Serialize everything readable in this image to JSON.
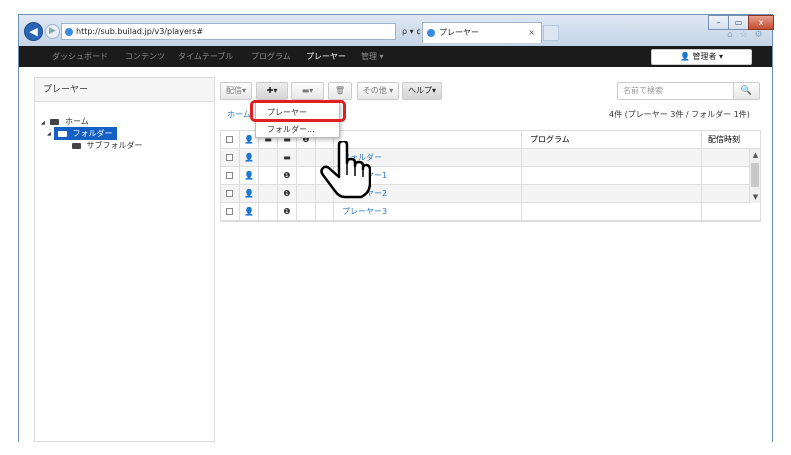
{
  "browser": {
    "url": "http://sub.builad.jp/v3/players#",
    "address_controls": "ρ ▾ ¢",
    "tab_title": "プレーヤー",
    "tab_close": "×",
    "window_min": "–",
    "window_max": "▭",
    "window_close": "x",
    "toolbar_icons": "⌂ ☆ ⚙"
  },
  "navbar": {
    "items": [
      "ダッシュボード",
      "コンテンツ",
      "タイムテーブル",
      "プログラム",
      "プレーヤー",
      "管理 ▾"
    ],
    "active_index": 4,
    "admin_label": "👤 管理者 ▾"
  },
  "sidebar": {
    "title": "プレーヤー",
    "tree": [
      {
        "label": "ホーム",
        "toggle": "◢"
      },
      {
        "label": "フォルダー",
        "toggle": "◢",
        "selected": true
      },
      {
        "label": "サブフォルダー"
      }
    ]
  },
  "toolbar": {
    "deliver_label": "配信▾",
    "add_label": "✚▾",
    "folder_label": "▬▾",
    "delete_label": "🗑",
    "other_label": "その他 ▾",
    "help_label": "ヘルプ▾"
  },
  "search": {
    "placeholder": "名前で検索",
    "icon": "🔍"
  },
  "breadcrumb": "ホーム",
  "count_text": "4件 (プレーヤー 3件 / フォルダー 1件)",
  "add_menu": {
    "items": [
      "プレーヤー",
      "フォルダー..."
    ]
  },
  "table": {
    "columns": [
      "",
      "👤",
      "▬",
      "▬",
      "❶",
      "",
      "",
      "プログラム",
      "配信時刻"
    ],
    "rows": [
      {
        "type": "folder",
        "name": "フォルダー",
        "program": "",
        "time": ""
      },
      {
        "type": "player",
        "name": "プレーヤー1",
        "program": "",
        "time": ""
      },
      {
        "type": "player",
        "name": "プレーヤー2",
        "program": "",
        "time": ""
      },
      {
        "type": "player",
        "name": "プレーヤー3",
        "program": "",
        "time": ""
      }
    ]
  },
  "colors": {
    "accent": "#2a7ac0",
    "selection": "#1560c4",
    "highlight": "#e02020",
    "navbar": "#1b1b1b"
  }
}
